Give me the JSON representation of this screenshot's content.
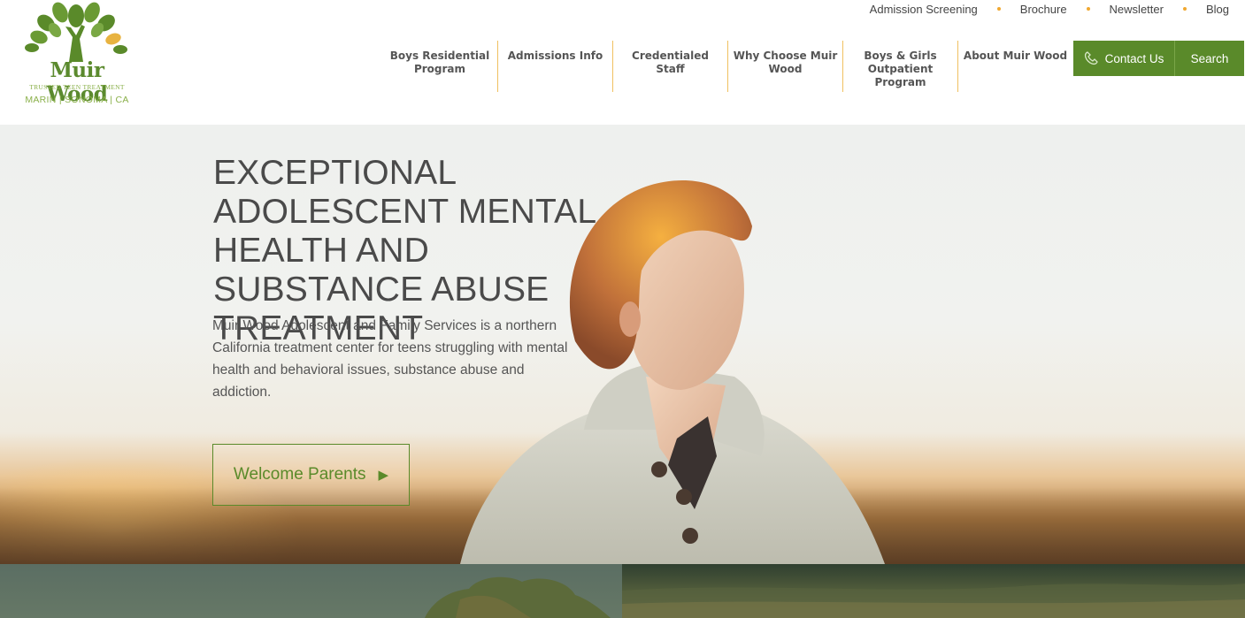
{
  "logo": {
    "name": "Muir Wood",
    "tagline": "TRUSTED TEEN TREATMENT",
    "locations": "MARIN  |  SONOMA  |  CA"
  },
  "utility_nav": [
    {
      "label": "Admission Screening"
    },
    {
      "label": "Brochure"
    },
    {
      "label": "Newsletter"
    },
    {
      "label": "Blog"
    }
  ],
  "main_nav": [
    {
      "label": "Boys Residential Program"
    },
    {
      "label": "Admissions Info"
    },
    {
      "label": "Credentialed Staff"
    },
    {
      "label": "Why Choose Muir Wood"
    },
    {
      "label": "Boys & Girls Outpatient Program"
    },
    {
      "label": "About Muir Wood"
    }
  ],
  "contact": {
    "label": "Contact Us",
    "icon": "phone-icon"
  },
  "search": {
    "label": "Search"
  },
  "hero": {
    "title": "EXCEPTIONAL ADOLESCENT MENTAL HEALTH AND SUBSTANCE ABUSE TREATMENT",
    "description": "Muir Wood Adolescent and Family Services is a northern California treatment center for teens struggling with mental health and behavioral issues, substance abuse and addiction.",
    "cta_label": "Welcome Parents",
    "cta_icon": "play-arrow-icon"
  },
  "colors": {
    "brand_green": "#5a8a2a",
    "divider_gold": "#f0c060",
    "dot_orange": "#f0a830"
  }
}
